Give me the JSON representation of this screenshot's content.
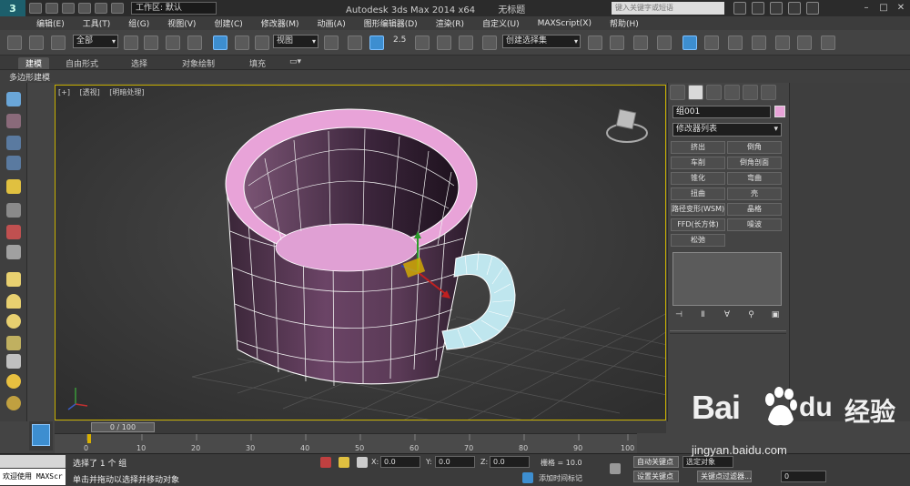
{
  "titlebar": {
    "logo": "3",
    "workspace": "工作区: 默认",
    "app_name": "Autodesk 3ds Max  2014 x64",
    "doc_name": "无标题",
    "search_placeholder": "键入关键字或短语"
  },
  "menubar": {
    "items": [
      "编辑(E)",
      "工具(T)",
      "组(G)",
      "视图(V)",
      "创建(C)",
      "修改器(M)",
      "动画(A)",
      "图形编辑器(D)",
      "渲染(R)",
      "自定义(U)",
      "MAXScript(X)",
      "帮助(H)"
    ]
  },
  "toolbar": {
    "selection_filter": "全部",
    "ref_coord": "视图",
    "snap_value": "2.5",
    "named_selection": "创建选择集"
  },
  "ribbon": {
    "tabs": [
      "建模",
      "自由形式",
      "选择",
      "对象绘制",
      "填充"
    ],
    "sub_label": "多边形建模"
  },
  "viewport": {
    "label_plus": "[+]",
    "label_view": "[透视]",
    "label_shading": "[明暗处理]",
    "accent_color": "#c8b000"
  },
  "command_panel": {
    "object_name": "组001",
    "object_color": "#e8a3d8",
    "modifier_list": "修改器列表",
    "modifiers": [
      "挤出",
      "倒角",
      "车削",
      "倒角剖面",
      "锥化",
      "弯曲",
      "扭曲",
      "壳",
      "路径变形(WSM)",
      "晶格",
      "FFD(长方体)",
      "噪波",
      "松弛"
    ]
  },
  "timeline": {
    "frame_label": "0 / 100",
    "ticks": [
      "0",
      "10",
      "20",
      "30",
      "40",
      "50",
      "60",
      "70",
      "80",
      "90",
      "100"
    ]
  },
  "statusbar": {
    "welcome": "欢迎使用 MAXScr",
    "selected": "选择了 1 个 组",
    "prompt": "单击并拖动以选择并移动对象",
    "x_label": "X:",
    "x_value": "0.0",
    "y_label": "Y:",
    "y_value": "0.0",
    "z_label": "Z:",
    "z_value": "0.0",
    "grid": "栅格 = 10.0",
    "add_time_tag": "添加时间标记",
    "auto_key": "自动关键点",
    "set_key": "设置关键点",
    "selected_dropdown": "选定对象",
    "key_filters": "关键点过滤器...",
    "frame_field": "0"
  },
  "watermark": {
    "bai": "Bai",
    "du": "du",
    "jingyan": "经验",
    "url": "jingyan.baidu.com"
  }
}
